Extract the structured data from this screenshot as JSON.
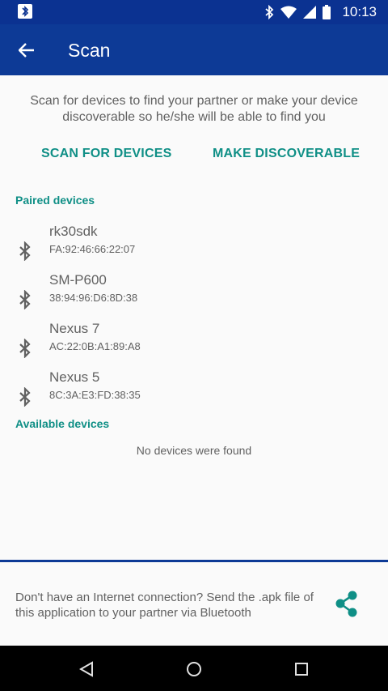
{
  "status_bar": {
    "time": "10:13",
    "icons": [
      "bluetooth-notification-icon",
      "bluetooth-icon",
      "wifi-icon",
      "signal-icon",
      "battery-icon"
    ]
  },
  "app_bar": {
    "title": "Scan",
    "back_icon": "arrow-back-icon"
  },
  "intro": {
    "text": "Scan for devices to find your partner or make your device discoverable so he/she will be able to find you"
  },
  "actions": {
    "scan_label": "SCAN FOR DEVICES",
    "discover_label": "MAKE DISCOVERABLE"
  },
  "paired": {
    "title": "Paired devices",
    "devices": [
      {
        "name": "rk30sdk",
        "address": "FA:92:46:66:22:07"
      },
      {
        "name": "SM-P600",
        "address": "38:94:96:D6:8D:38"
      },
      {
        "name": "Nexus 7",
        "address": "AC:22:0B:A1:89:A8"
      },
      {
        "name": "Nexus 5",
        "address": "8C:3A:E3:FD:38:35"
      }
    ]
  },
  "available": {
    "title": "Available devices",
    "empty_text": "No devices were found"
  },
  "footer": {
    "text": "Don't have an Internet connection? Send the .apk file of this application to your partner via Bluetooth",
    "share_icon": "share-icon"
  },
  "colors": {
    "primary": "#0d3a96",
    "accent": "#0f8f86",
    "text": "#616161"
  }
}
